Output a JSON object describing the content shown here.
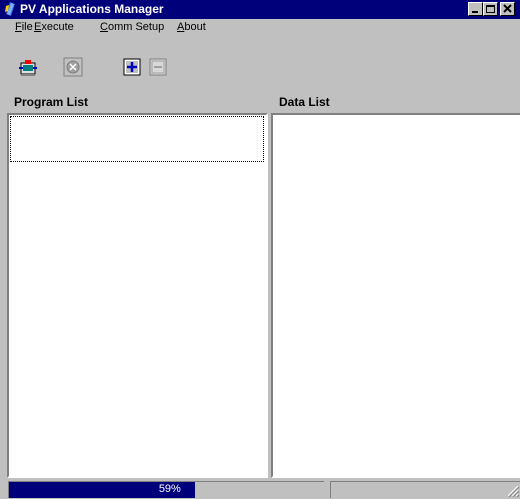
{
  "window": {
    "title": "PV Applications Manager",
    "controls": {
      "minimize": "minimize-icon",
      "maximize": "maximize-icon",
      "close": "close-icon"
    }
  },
  "menu": {
    "items": [
      {
        "label": "File",
        "accel": "F",
        "rest": "ile"
      },
      {
        "label": "Execute",
        "accel": "E",
        "rest": "xecute"
      },
      {
        "label": "Comm Setup",
        "accel": "C",
        "rest": "omm Setup"
      },
      {
        "label": "About",
        "accel": "A",
        "rest": "bout"
      }
    ]
  },
  "toolbar": {
    "tools": [
      {
        "icon": "transfer-icon",
        "enabled": true
      },
      {
        "icon": "stop-icon",
        "enabled": false
      },
      {
        "icon": "add-icon",
        "enabled": true
      },
      {
        "icon": "remove-icon",
        "enabled": false
      }
    ]
  },
  "panels": {
    "program_list": {
      "header": "Program List"
    },
    "data_list": {
      "header": "Data List"
    }
  },
  "status": {
    "progress_text": "59%",
    "progress": 0.59
  },
  "colors": {
    "title_bar": "#00007b",
    "face": "#c0c0c0",
    "progress_fill": "#00007b"
  }
}
